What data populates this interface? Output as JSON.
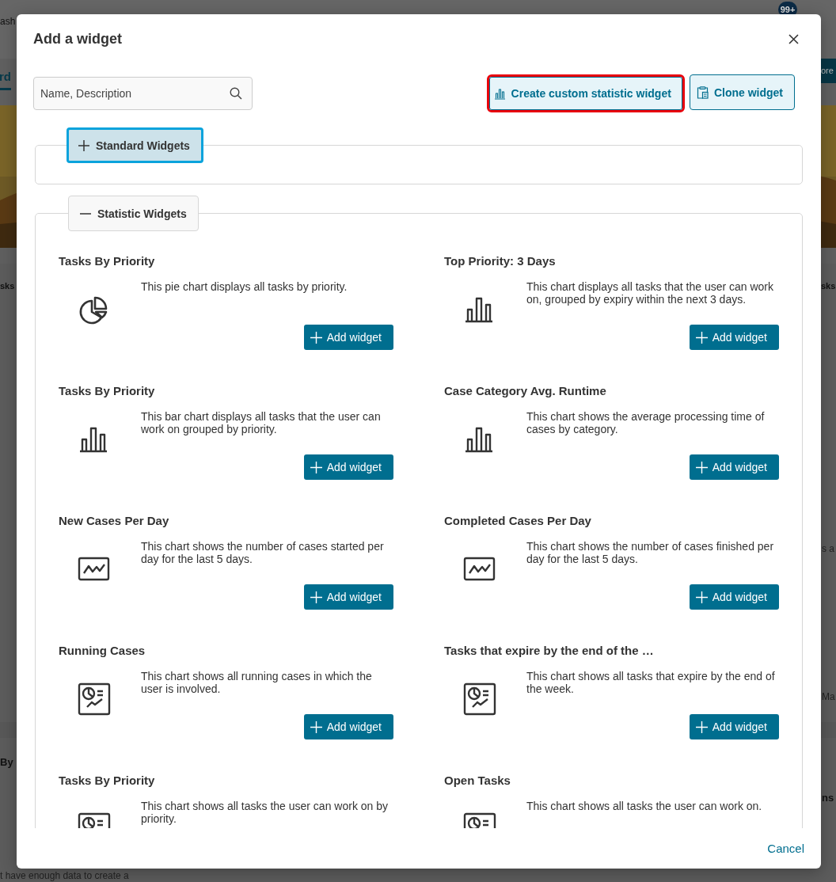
{
  "background": {
    "texts": [
      "ash",
      "99+",
      "rd",
      "ore",
      "sks",
      "sks",
      "s a",
      "Ma",
      "By",
      "ns",
      "t have enough data to create a"
    ]
  },
  "dialog": {
    "title": "Add a widget",
    "search": {
      "placeholder": "Name, Description"
    },
    "actions": [
      {
        "label": "Create custom statistic widget",
        "highlighted": true
      },
      {
        "label": "Clone widget",
        "highlighted": false
      }
    ],
    "groups": [
      {
        "label": "Standard Widgets",
        "expanded": false,
        "focused": true
      },
      {
        "label": "Statistic Widgets",
        "expanded": true,
        "focused": false,
        "widgets": [
          {
            "title": "Tasks By Priority",
            "kind": "pie",
            "description": "This pie chart displays all tasks by priority.",
            "button": "Add widget"
          },
          {
            "title": "Top Priority: 3 Days",
            "kind": "bar",
            "description": "This chart displays all tasks that the user can work on, grouped by expiry within the next 3 days.",
            "button": "Add widget"
          },
          {
            "title": "Tasks By Priority",
            "kind": "bar",
            "description": "This bar chart displays all tasks that the user can work on grouped by priority.",
            "button": "Add widget"
          },
          {
            "title": "Case Category Avg. Runtime",
            "kind": "bar",
            "description": "This chart shows the average processing time of cases by category.",
            "button": "Add widget"
          },
          {
            "title": "New Cases Per Day",
            "kind": "line",
            "description": "This chart shows the number of cases started per day for the last 5 days.",
            "button": "Add widget"
          },
          {
            "title": "Completed Cases Per Day",
            "kind": "line",
            "description": "This chart shows the number of cases finished per day for the last 5 days.",
            "button": "Add widget"
          },
          {
            "title": "Running Cases",
            "kind": "report",
            "description": "This chart shows all running cases in which the user is involved.",
            "button": "Add widget"
          },
          {
            "title": "Tasks that expire by the end of the …",
            "kind": "report",
            "description": "This chart shows all tasks that expire by the end of the week.",
            "button": "Add widget"
          },
          {
            "title": "Tasks By Priority",
            "kind": "report",
            "description": "This chart shows all tasks the user can work on by priority."
          },
          {
            "title": "Open Tasks",
            "kind": "report",
            "description": "This chart shows all tasks the user can work on."
          }
        ]
      }
    ],
    "cancel": "Cancel"
  }
}
